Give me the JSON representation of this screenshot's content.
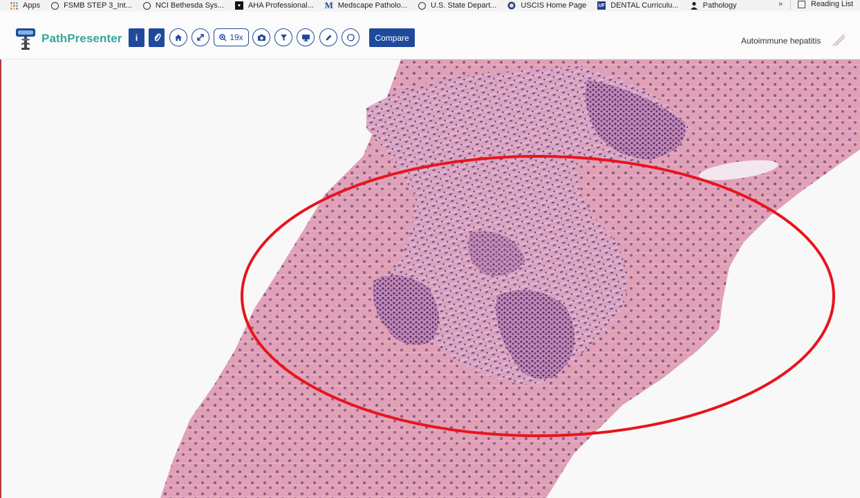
{
  "bookmarks": [
    {
      "label": "Apps",
      "icon": "apps-grid-icon"
    },
    {
      "label": "FSMB STEP 3_Int...",
      "icon": "globe-icon"
    },
    {
      "label": "NCI Bethesda Sys...",
      "icon": "globe-icon"
    },
    {
      "label": "AHA Professional...",
      "icon": "aha-icon"
    },
    {
      "label": "Medscape Patholo...",
      "icon": "medscape-icon"
    },
    {
      "label": "U.S. State Depart...",
      "icon": "globe-icon"
    },
    {
      "label": "USCIS Home Page",
      "icon": "uscis-seal-icon"
    },
    {
      "label": "DENTAL Curriculu...",
      "icon": "uf-icon"
    },
    {
      "label": "Pathology",
      "icon": "person-icon"
    }
  ],
  "bookmarks_more": "»",
  "reading_list": "Reading List",
  "header": {
    "brand": "PathPresenter",
    "zoom_label": "19x",
    "compare_label": "Compare",
    "case_title": "Autoimmune hepatitis"
  },
  "colors": {
    "brand_teal": "#36a59a",
    "toolbar_blue": "#1f4a9b",
    "annotation_red": "#e8141c",
    "tissue_pink": "#dc97ad",
    "nuclei_purple": "#5a3a7a"
  }
}
